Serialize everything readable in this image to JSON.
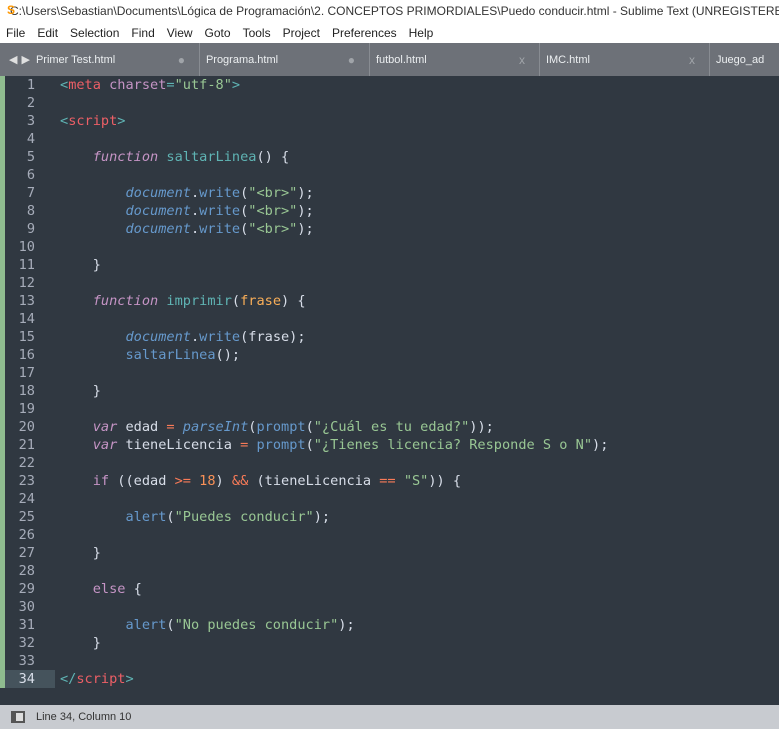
{
  "window": {
    "title": "C:\\Users\\Sebastian\\Documents\\Lógica de Programación\\2. CONCEPTOS PRIMORDIALES\\Puedo conducir.html - Sublime Text (UNREGISTERED)"
  },
  "menu": [
    "File",
    "Edit",
    "Selection",
    "Find",
    "View",
    "Goto",
    "Tools",
    "Project",
    "Preferences",
    "Help"
  ],
  "tabs": [
    {
      "label": "Primer Test.html",
      "state": "●"
    },
    {
      "label": "Programa.html",
      "state": "●"
    },
    {
      "label": "futbol.html",
      "state": "x"
    },
    {
      "label": "IMC.html",
      "state": "x"
    },
    {
      "label": "Juego_ad",
      "state": ""
    }
  ],
  "editor": {
    "current_line": 34,
    "lines": [
      [
        [
          "punc",
          "<"
        ],
        [
          "tag",
          "meta"
        ],
        [
          "txt",
          " "
        ],
        [
          "attr",
          "charset"
        ],
        [
          "punc",
          "="
        ],
        [
          "str",
          "\"utf-8\""
        ],
        [
          "punc",
          ">"
        ]
      ],
      [],
      [
        [
          "punc",
          "<"
        ],
        [
          "tag",
          "script"
        ],
        [
          "punc",
          ">"
        ]
      ],
      [],
      [
        [
          "txt",
          "    "
        ],
        [
          "kw",
          "function"
        ],
        [
          "txt",
          " "
        ],
        [
          "fn",
          "saltarLinea"
        ],
        [
          "txt",
          "() {"
        ]
      ],
      [],
      [
        [
          "txt",
          "        "
        ],
        [
          "obj",
          "document"
        ],
        [
          "txt",
          "."
        ],
        [
          "call",
          "write"
        ],
        [
          "txt",
          "("
        ],
        [
          "str",
          "\"<br>\""
        ],
        [
          "txt",
          ");"
        ]
      ],
      [
        [
          "txt",
          "        "
        ],
        [
          "obj",
          "document"
        ],
        [
          "txt",
          "."
        ],
        [
          "call",
          "write"
        ],
        [
          "txt",
          "("
        ],
        [
          "str",
          "\"<br>\""
        ],
        [
          "txt",
          ");"
        ]
      ],
      [
        [
          "txt",
          "        "
        ],
        [
          "obj",
          "document"
        ],
        [
          "txt",
          "."
        ],
        [
          "call",
          "write"
        ],
        [
          "txt",
          "("
        ],
        [
          "str",
          "\"<br>\""
        ],
        [
          "txt",
          ");"
        ]
      ],
      [],
      [
        [
          "txt",
          "    }"
        ]
      ],
      [],
      [
        [
          "txt",
          "    "
        ],
        [
          "kw",
          "function"
        ],
        [
          "txt",
          " "
        ],
        [
          "fn",
          "imprimir"
        ],
        [
          "txt",
          "("
        ],
        [
          "param",
          "frase"
        ],
        [
          "txt",
          ") {"
        ]
      ],
      [],
      [
        [
          "txt",
          "        "
        ],
        [
          "obj",
          "document"
        ],
        [
          "txt",
          "."
        ],
        [
          "call",
          "write"
        ],
        [
          "txt",
          "(frase);"
        ]
      ],
      [
        [
          "txt",
          "        "
        ],
        [
          "call",
          "saltarLinea"
        ],
        [
          "txt",
          "();"
        ]
      ],
      [],
      [
        [
          "txt",
          "    }"
        ]
      ],
      [],
      [
        [
          "txt",
          "    "
        ],
        [
          "kw",
          "var"
        ],
        [
          "txt",
          " edad "
        ],
        [
          "op",
          "="
        ],
        [
          "txt",
          " "
        ],
        [
          "obj",
          "parseInt"
        ],
        [
          "txt",
          "("
        ],
        [
          "call",
          "prompt"
        ],
        [
          "txt",
          "("
        ],
        [
          "str",
          "\"¿Cuál es tu edad?\""
        ],
        [
          "txt",
          "));"
        ]
      ],
      [
        [
          "txt",
          "    "
        ],
        [
          "kw",
          "var"
        ],
        [
          "txt",
          " tieneLicencia "
        ],
        [
          "op",
          "="
        ],
        [
          "txt",
          " "
        ],
        [
          "call",
          "prompt"
        ],
        [
          "txt",
          "("
        ],
        [
          "str",
          "\"¿Tienes licencia? Responde S o N\""
        ],
        [
          "txt",
          ");"
        ]
      ],
      [],
      [
        [
          "txt",
          "    "
        ],
        [
          "kwp",
          "if"
        ],
        [
          "txt",
          " ((edad "
        ],
        [
          "op",
          ">="
        ],
        [
          "txt",
          " "
        ],
        [
          "num",
          "18"
        ],
        [
          "txt",
          ") "
        ],
        [
          "op",
          "&&"
        ],
        [
          "txt",
          " (tieneLicencia "
        ],
        [
          "op",
          "=="
        ],
        [
          "txt",
          " "
        ],
        [
          "str",
          "\"S\""
        ],
        [
          "txt",
          ")) {"
        ]
      ],
      [],
      [
        [
          "txt",
          "        "
        ],
        [
          "call",
          "alert"
        ],
        [
          "txt",
          "("
        ],
        [
          "str",
          "\"Puedes conducir\""
        ],
        [
          "txt",
          ");"
        ]
      ],
      [],
      [
        [
          "txt",
          "    }"
        ]
      ],
      [],
      [
        [
          "txt",
          "    "
        ],
        [
          "kwp",
          "else"
        ],
        [
          "txt",
          " {"
        ]
      ],
      [],
      [
        [
          "txt",
          "        "
        ],
        [
          "call",
          "alert"
        ],
        [
          "txt",
          "("
        ],
        [
          "str",
          "\"No puedes conducir\""
        ],
        [
          "txt",
          ");"
        ]
      ],
      [
        [
          "txt",
          "    }"
        ]
      ],
      [],
      [
        [
          "punc",
          "</"
        ],
        [
          "tag",
          "script"
        ],
        [
          "punc",
          ">"
        ]
      ]
    ]
  },
  "status": {
    "position": "Line 34, Column 10"
  }
}
